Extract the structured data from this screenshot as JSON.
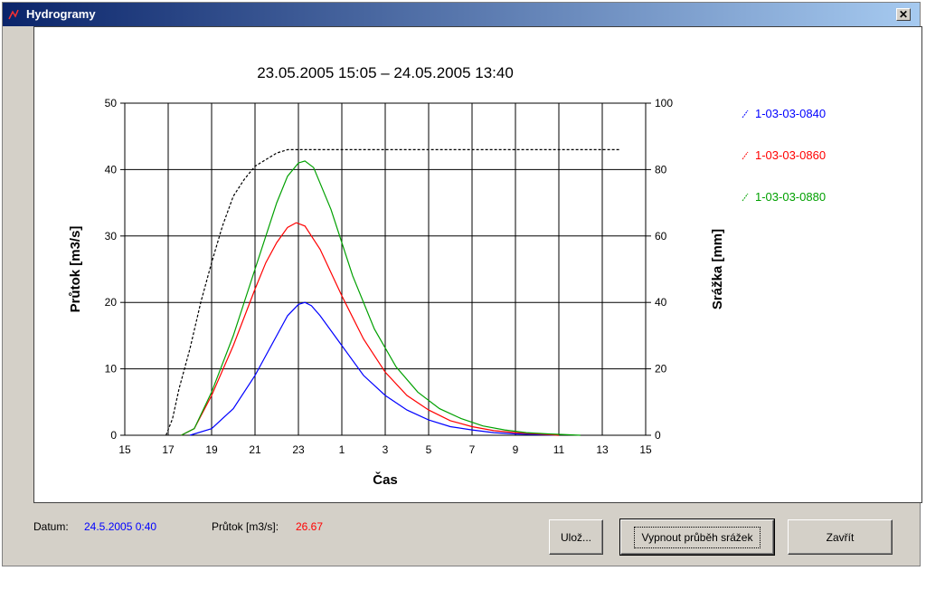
{
  "window": {
    "title": "Hydrogramy",
    "close_label": "✕"
  },
  "status": {
    "datum_label": "Datum:",
    "datum_value": "24.5.2005 0:40",
    "prutok_label": "Průtok [m3/s]:",
    "prutok_value": "26.67"
  },
  "buttons": {
    "save": "Ulož...",
    "toggle_rain": "Vypnout průběh srážek",
    "close": "Zavřít"
  },
  "colors": {
    "series1": "#0000ff",
    "series2": "#ff0000",
    "series3": "#00a000",
    "rain": "#000000"
  },
  "chart_data": {
    "type": "line",
    "title": "23.05.2005 15:05 – 24.05.2005 13:40",
    "xlabel": "Čas",
    "ylabel": "Průtok [m3/s]",
    "y2label": "Srážka [mm]",
    "x_unit": "hours from 15:00 on 23.05.2005",
    "xlim": [
      0,
      24
    ],
    "ylim": [
      0,
      50
    ],
    "y2lim": [
      0,
      100
    ],
    "x_ticks": [
      0,
      2,
      4,
      6,
      8,
      10,
      12,
      14,
      16,
      18,
      20,
      22,
      24
    ],
    "x_tick_labels": [
      "15",
      "17",
      "19",
      "21",
      "23",
      "1",
      "3",
      "5",
      "7",
      "9",
      "11",
      "13",
      "15"
    ],
    "y_ticks": [
      0,
      10,
      20,
      30,
      40,
      50
    ],
    "y2_ticks": [
      0,
      20,
      40,
      60,
      80,
      100
    ],
    "grid": true,
    "legend_position": "right",
    "series": [
      {
        "name": "1-03-03-0840",
        "axis": "left",
        "color": "#0000ff",
        "points": [
          [
            3.0,
            0
          ],
          [
            4.0,
            1
          ],
          [
            5.0,
            4
          ],
          [
            6.0,
            9
          ],
          [
            6.5,
            12
          ],
          [
            7.0,
            15
          ],
          [
            7.5,
            18
          ],
          [
            8.0,
            19.7
          ],
          [
            8.3,
            20
          ],
          [
            8.6,
            19.5
          ],
          [
            9.0,
            18
          ],
          [
            10.0,
            13.5
          ],
          [
            11.0,
            9
          ],
          [
            12.0,
            6
          ],
          [
            13.0,
            3.8
          ],
          [
            14.0,
            2.3
          ],
          [
            15.0,
            1.3
          ],
          [
            16.0,
            0.8
          ],
          [
            17.0,
            0.4
          ],
          [
            18.0,
            0.2
          ],
          [
            19.0,
            0.1
          ],
          [
            20.0,
            0
          ]
        ]
      },
      {
        "name": "1-03-03-0860",
        "axis": "left",
        "color": "#ff0000",
        "points": [
          [
            2.6,
            0
          ],
          [
            3.2,
            1
          ],
          [
            4.0,
            6
          ],
          [
            5.0,
            13.5
          ],
          [
            6.0,
            22
          ],
          [
            6.5,
            26
          ],
          [
            7.0,
            29
          ],
          [
            7.5,
            31.3
          ],
          [
            7.9,
            32
          ],
          [
            8.3,
            31.5
          ],
          [
            9.0,
            28
          ],
          [
            10.0,
            21
          ],
          [
            11.0,
            14.5
          ],
          [
            12.0,
            9.5
          ],
          [
            13.0,
            6
          ],
          [
            14.0,
            3.8
          ],
          [
            15.0,
            2.2
          ],
          [
            16.0,
            1.3
          ],
          [
            17.0,
            0.7
          ],
          [
            18.0,
            0.4
          ],
          [
            19.0,
            0.2
          ],
          [
            20.0,
            0
          ]
        ]
      },
      {
        "name": "1-03-03-0880",
        "axis": "left",
        "color": "#00a000",
        "points": [
          [
            2.6,
            0
          ],
          [
            3.2,
            1
          ],
          [
            4.0,
            6.5
          ],
          [
            5.0,
            15
          ],
          [
            6.0,
            25
          ],
          [
            6.5,
            30
          ],
          [
            7.0,
            35
          ],
          [
            7.5,
            39
          ],
          [
            8.0,
            41
          ],
          [
            8.3,
            41.3
          ],
          [
            8.7,
            40.3
          ],
          [
            9.5,
            34
          ],
          [
            10.5,
            24
          ],
          [
            11.5,
            16
          ],
          [
            12.5,
            10.3
          ],
          [
            13.5,
            6.5
          ],
          [
            14.5,
            4
          ],
          [
            15.5,
            2.5
          ],
          [
            16.5,
            1.4
          ],
          [
            17.5,
            0.8
          ],
          [
            18.5,
            0.4
          ],
          [
            19.5,
            0.2
          ],
          [
            21.0,
            0
          ]
        ]
      },
      {
        "name": "",
        "axis": "right",
        "color": "#000000",
        "dashed": true,
        "points": [
          [
            1.9,
            0
          ],
          [
            2.2,
            5
          ],
          [
            2.5,
            14
          ],
          [
            3.0,
            26
          ],
          [
            3.5,
            40
          ],
          [
            4.0,
            52
          ],
          [
            4.5,
            63
          ],
          [
            5.0,
            72
          ],
          [
            5.5,
            77
          ],
          [
            6.0,
            81
          ],
          [
            6.5,
            83
          ],
          [
            7.0,
            85
          ],
          [
            7.5,
            86
          ],
          [
            8.0,
            86
          ],
          [
            22.8,
            86
          ]
        ]
      }
    ]
  }
}
